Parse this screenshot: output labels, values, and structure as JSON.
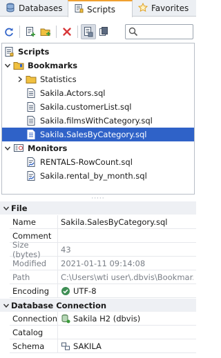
{
  "tabs": [
    {
      "label": "Databases",
      "icon": "database-icon"
    },
    {
      "label": "Scripts",
      "icon": "scripts-folder-icon",
      "active": true
    },
    {
      "label": "Favorites",
      "icon": "star-icon"
    }
  ],
  "toolbar": {
    "buttons": [
      "refresh",
      "new-script",
      "new-folder",
      "delete",
      "link-editor",
      "collapse"
    ],
    "search_value": ""
  },
  "tree": {
    "root": "Scripts",
    "bookmarks": "Bookmarks",
    "statistics": "Statistics",
    "files": [
      "Sakila.Actors.sql",
      "Sakila.customerList.sql",
      "Sakila.filmsWithCategory.sql",
      "Sakila.SalesByCategory.sql"
    ],
    "monitors": "Monitors",
    "monitor_files": [
      "RENTALS-RowCount.sql",
      "Sakila.rental_by_month.sql"
    ]
  },
  "splitter": "·····",
  "file_section": {
    "title": "File",
    "rows": [
      {
        "name": "Name",
        "value": "Sakila.SalesByCategory.sql"
      },
      {
        "name": "Comment",
        "value": ""
      },
      {
        "name": "Size (bytes)",
        "value": "43"
      },
      {
        "name": "Modified",
        "value": "2021-01-11 09:14:08"
      },
      {
        "name": "Path",
        "value": "C:\\Users\\wti user\\.dbvis\\Bookmar..."
      },
      {
        "name": "Encoding",
        "value": "UTF-8"
      }
    ]
  },
  "db_section": {
    "title": "Database Connection",
    "rows": [
      {
        "name": "Connection",
        "value": "Sakila H2 (dbvis)"
      },
      {
        "name": "Catalog",
        "value": ""
      },
      {
        "name": "Schema",
        "value": "SAKILA"
      }
    ]
  },
  "colors": {
    "selection": "#2f62c8",
    "accent_tab": "#f0a030"
  }
}
